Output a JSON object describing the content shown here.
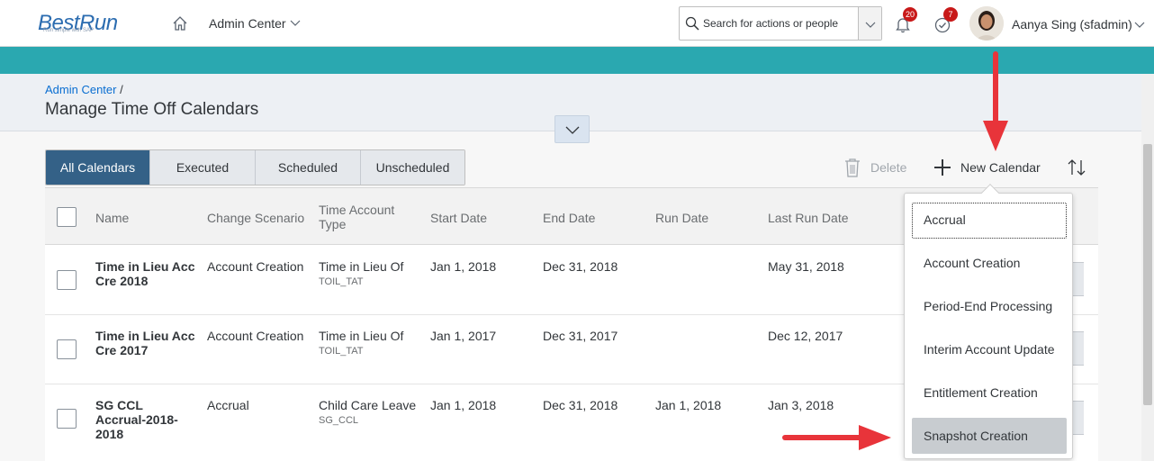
{
  "shell": {
    "logo_text": "BestRun",
    "logo_tagline": "Run simple with SAP",
    "nav_title": "Admin Center",
    "search_placeholder": "Search for actions or people",
    "notifications_count": "20",
    "tasks_count": "7",
    "user_name": "Aanya Sing (sfadmin)"
  },
  "header": {
    "breadcrumb_link": "Admin Center",
    "breadcrumb_sep": "/",
    "page_title": "Manage Time Off Calendars"
  },
  "tabs": [
    {
      "label": "All Calendars",
      "active": true
    },
    {
      "label": "Executed",
      "active": false
    },
    {
      "label": "Scheduled",
      "active": false
    },
    {
      "label": "Unscheduled",
      "active": false
    }
  ],
  "toolbar": {
    "delete_label": "Delete",
    "new_calendar_label": "New Calendar"
  },
  "table": {
    "columns": [
      "Name",
      "Change Scenario",
      "Time Account Type",
      "Start Date",
      "End Date",
      "Run Date",
      "Last Run Date"
    ],
    "rows": [
      {
        "name": "Time in Lieu Acc Cre 2018",
        "scenario": "Account Creation",
        "type": "Time in Lieu Of",
        "type_code": "TOIL_TAT",
        "start": "Jan 1, 2018",
        "end": "Dec 31, 2018",
        "run": "",
        "last_run": "May 31, 2018"
      },
      {
        "name": "Time in Lieu Acc Cre 2017",
        "scenario": "Account Creation",
        "type": "Time in Lieu Of",
        "type_code": "TOIL_TAT",
        "start": "Jan 1, 2017",
        "end": "Dec 31, 2017",
        "run": "",
        "last_run": "Dec 12, 2017"
      },
      {
        "name": "SG CCL Accrual-2018-2018",
        "scenario": "Accrual",
        "type": "Child Care Leave",
        "type_code": "SG_CCL",
        "start": "Jan 1, 2018",
        "end": "Dec 31, 2018",
        "run": "Jan 1, 2018",
        "last_run": "Jan 3, 2018"
      }
    ]
  },
  "dropdown": {
    "items": [
      "Accrual",
      "Account Creation",
      "Period-End Processing",
      "Interim Account Update",
      "Entitlement Creation",
      "Snapshot Creation"
    ]
  },
  "colors": {
    "teal_band": "#2aa8b0",
    "active_tab": "#346187",
    "link": "#0a6ed1",
    "badge": "#c81919",
    "annotation_arrow": "#e8343a"
  }
}
